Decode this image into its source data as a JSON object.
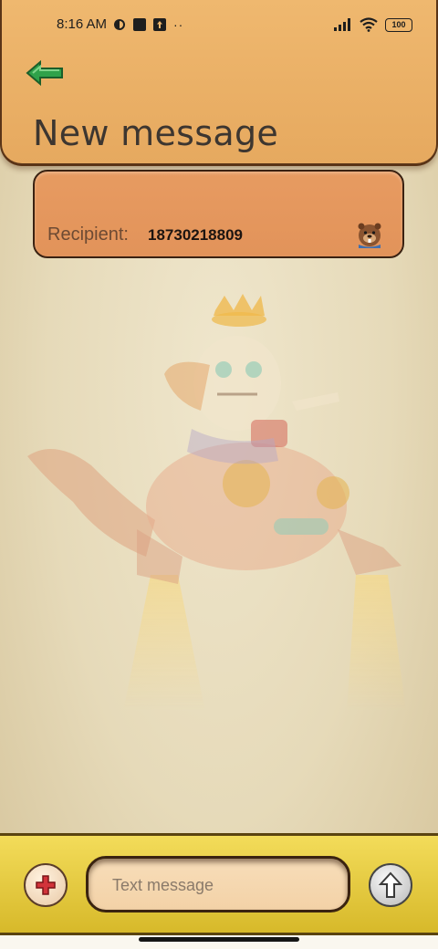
{
  "status_bar": {
    "time": "8:16 AM",
    "battery": "100"
  },
  "header": {
    "title": "New message",
    "back_icon": "arrow-left-icon"
  },
  "recipient": {
    "label": "Recipient:",
    "value": "18730218809",
    "avatar_icon": "beaver-avatar-icon"
  },
  "compose": {
    "placeholder": "Text message",
    "add_icon": "plus-icon",
    "send_icon": "arrow-up-icon"
  },
  "colors": {
    "header_bg": "#e9ad63",
    "recipient_bg": "#e4975c",
    "bottom_bar": "#e6c940",
    "back_arrow": "#2fa24a",
    "add_plus": "#d2333a"
  }
}
